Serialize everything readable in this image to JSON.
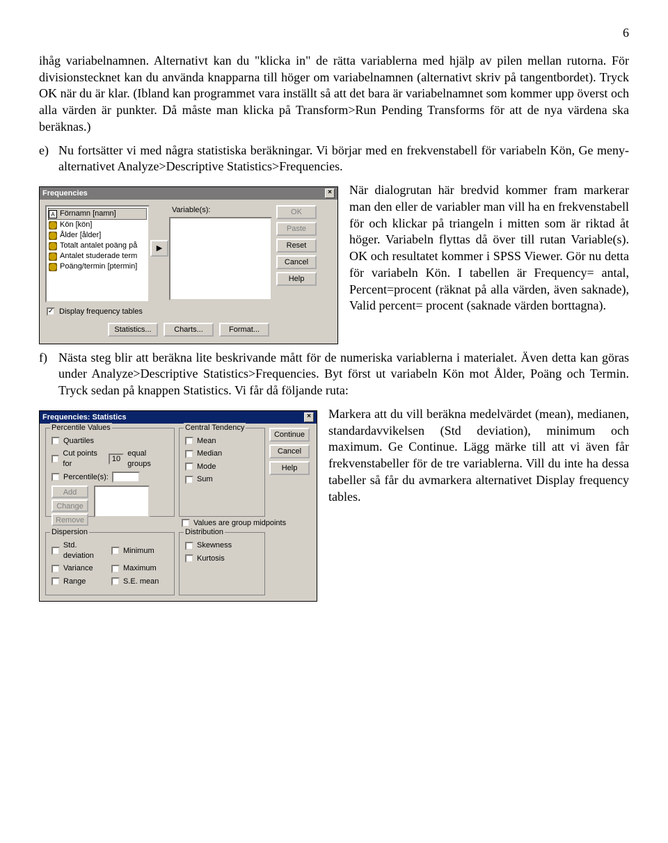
{
  "page_number": "6",
  "para_intro": "ihåg variabelnamnen. Alternativt kan du \"klicka in\" de rätta variablerna med hjälp av pilen mellan rutorna. För divisionstecknet kan du använda knapparna till höger om variabelnamnen (alternativt skriv på tangentbordet). Tryck OK när du är klar. (Ibland kan programmet vara inställt så att det bara är variabelnamnet som kommer upp överst och alla värden är punkter. Då måste man klicka på Transform>Run Pending Transforms för att de nya värdena ska beräknas.)",
  "item_e": {
    "letter": "e)",
    "lead": "Nu fortsätter vi med några statistiska beräkningar. Vi börjar med en frekvenstabell för variabeln Kön, Ge meny-alternativet Analyze>Descriptive Statistics>Frequencies.",
    "wrap": "När dialogrutan här bredvid kommer fram markerar man den eller de variabler man vill ha en frekvenstabell för och klickar på triangeln i mitten som är riktad åt höger. Variabeln flyttas då över till rutan Variable(s). OK och resultatet kommer i SPSS Viewer. Gör nu detta för variabeln Kön. I tabellen är Frequency= antal, Percent=procent (räknat på alla värden, även saknade), Valid percent= procent (saknade värden borttagna)."
  },
  "item_f": {
    "letter": "f)",
    "text": "Nästa steg blir att beräkna lite beskrivande mått för de numeriska variablerna i materialet. Även detta kan göras under Analyze>Descriptive Statistics>Frequencies. Byt först ut variabeln Kön mot Ålder, Poäng och Termin. Tryck sedan på knappen Statistics. Vi får då följande ruta:"
  },
  "para_last": "Markera att du vill beräkna medelvärdet (mean), medianen, standardavvikelsen (Std deviation), minimum och maximum. Ge Continue. Lägg märke till att vi även får frekvenstabeller för de tre variablerna. Vill du inte ha dessa tabeller så får du avmarkera alternativet Display frequency tables.",
  "dialog1": {
    "title": "Frequencies",
    "close": "×",
    "variable_label": "Variable(s):",
    "items": [
      "Förnamn [namn]",
      "Kön [kön]",
      "Ålder [ålder]",
      "Totalt antalet poäng på",
      "Antalet studerade term",
      "Poäng/termin [ptermin]"
    ],
    "display_freq": "Display frequency tables",
    "move_arrow": "▶",
    "buttons": {
      "ok": "OK",
      "paste": "Paste",
      "reset": "Reset",
      "cancel": "Cancel",
      "help": "Help"
    },
    "bottom": {
      "statistics": "Statistics...",
      "charts": "Charts...",
      "format": "Format..."
    }
  },
  "dialog2": {
    "title": "Frequencies: Statistics",
    "close": "×",
    "groups": {
      "pv": "Percentile Values",
      "ct": "Central Tendency",
      "dp": "Dispersion",
      "dist": "Distribution"
    },
    "pv": {
      "quartiles": "Quartiles",
      "cutpoints_pre": "Cut points for",
      "cutpoints_val": "10",
      "cutpoints_post": "equal groups",
      "percentiles": "Percentile(s):",
      "add": "Add",
      "change": "Change",
      "remove": "Remove"
    },
    "ct": {
      "mean": "Mean",
      "median": "Median",
      "mode": "Mode",
      "sum": "Sum"
    },
    "values_mid": "Values are group midpoints",
    "dp": {
      "std": "Std. deviation",
      "var": "Variance",
      "range": "Range",
      "min": "Minimum",
      "max": "Maximum",
      "se": "S.E. mean"
    },
    "dist": {
      "skew": "Skewness",
      "kurt": "Kurtosis"
    },
    "buttons": {
      "continue": "Continue",
      "cancel": "Cancel",
      "help": "Help"
    }
  }
}
